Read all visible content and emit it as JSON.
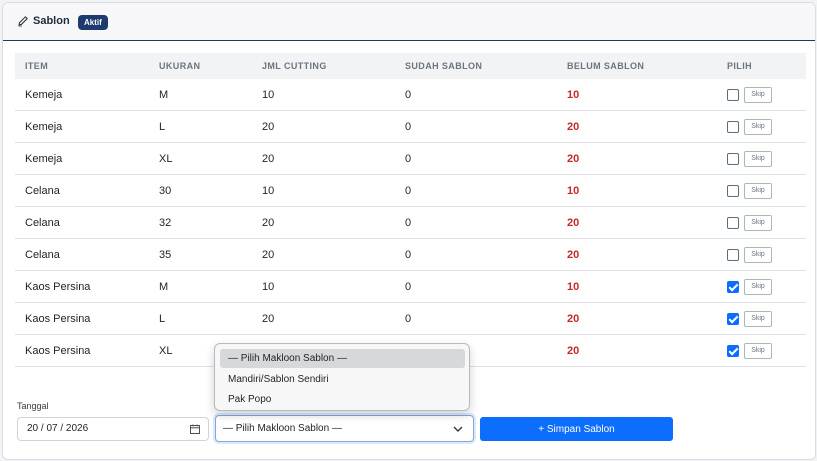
{
  "header": {
    "title": "Sablon",
    "badge": "Aktif",
    "icon": "pencil-icon"
  },
  "table": {
    "columns": [
      "ITEM",
      "UKURAN",
      "JML CUTTING",
      "SUDAH SABLON",
      "BELUM SABLON",
      "PILIH"
    ],
    "rows": [
      {
        "item": "Kemeja",
        "ukuran": "M",
        "cutting": "10",
        "sudah": "0",
        "belum": "10",
        "checked": false,
        "skip": "Skip"
      },
      {
        "item": "Kemeja",
        "ukuran": "L",
        "cutting": "20",
        "sudah": "0",
        "belum": "20",
        "checked": false,
        "skip": "Skip"
      },
      {
        "item": "Kemeja",
        "ukuran": "XL",
        "cutting": "20",
        "sudah": "0",
        "belum": "20",
        "checked": false,
        "skip": "Skip"
      },
      {
        "item": "Celana",
        "ukuran": "30",
        "cutting": "10",
        "sudah": "0",
        "belum": "10",
        "checked": false,
        "skip": "Skip"
      },
      {
        "item": "Celana",
        "ukuran": "32",
        "cutting": "20",
        "sudah": "0",
        "belum": "20",
        "checked": false,
        "skip": "Skip"
      },
      {
        "item": "Celana",
        "ukuran": "35",
        "cutting": "20",
        "sudah": "0",
        "belum": "20",
        "checked": false,
        "skip": "Skip"
      },
      {
        "item": "Kaos Persina",
        "ukuran": "M",
        "cutting": "10",
        "sudah": "0",
        "belum": "10",
        "checked": true,
        "skip": "Skip"
      },
      {
        "item": "Kaos Persina",
        "ukuran": "L",
        "cutting": "20",
        "sudah": "0",
        "belum": "20",
        "checked": true,
        "skip": "Skip"
      },
      {
        "item": "Kaos Persina",
        "ukuran": "XL",
        "cutting": "",
        "sudah": "",
        "belum": "20",
        "checked": true,
        "skip": "Skip"
      }
    ]
  },
  "form": {
    "tanggal_label": "Tanggal",
    "tanggal_value": "20 / 07 / 2026",
    "makloon_selected": "— Pilih Makloon Sablon —",
    "makloon_options": [
      "— Pilih Makloon Sablon —",
      "Mandiri/Sablon Sendiri",
      "Pak Popo"
    ],
    "submit_label": "+ Simpan Sablon"
  },
  "colors": {
    "accent": "#0d6efd",
    "badge": "#1e3a6e",
    "danger": "#c62828"
  }
}
